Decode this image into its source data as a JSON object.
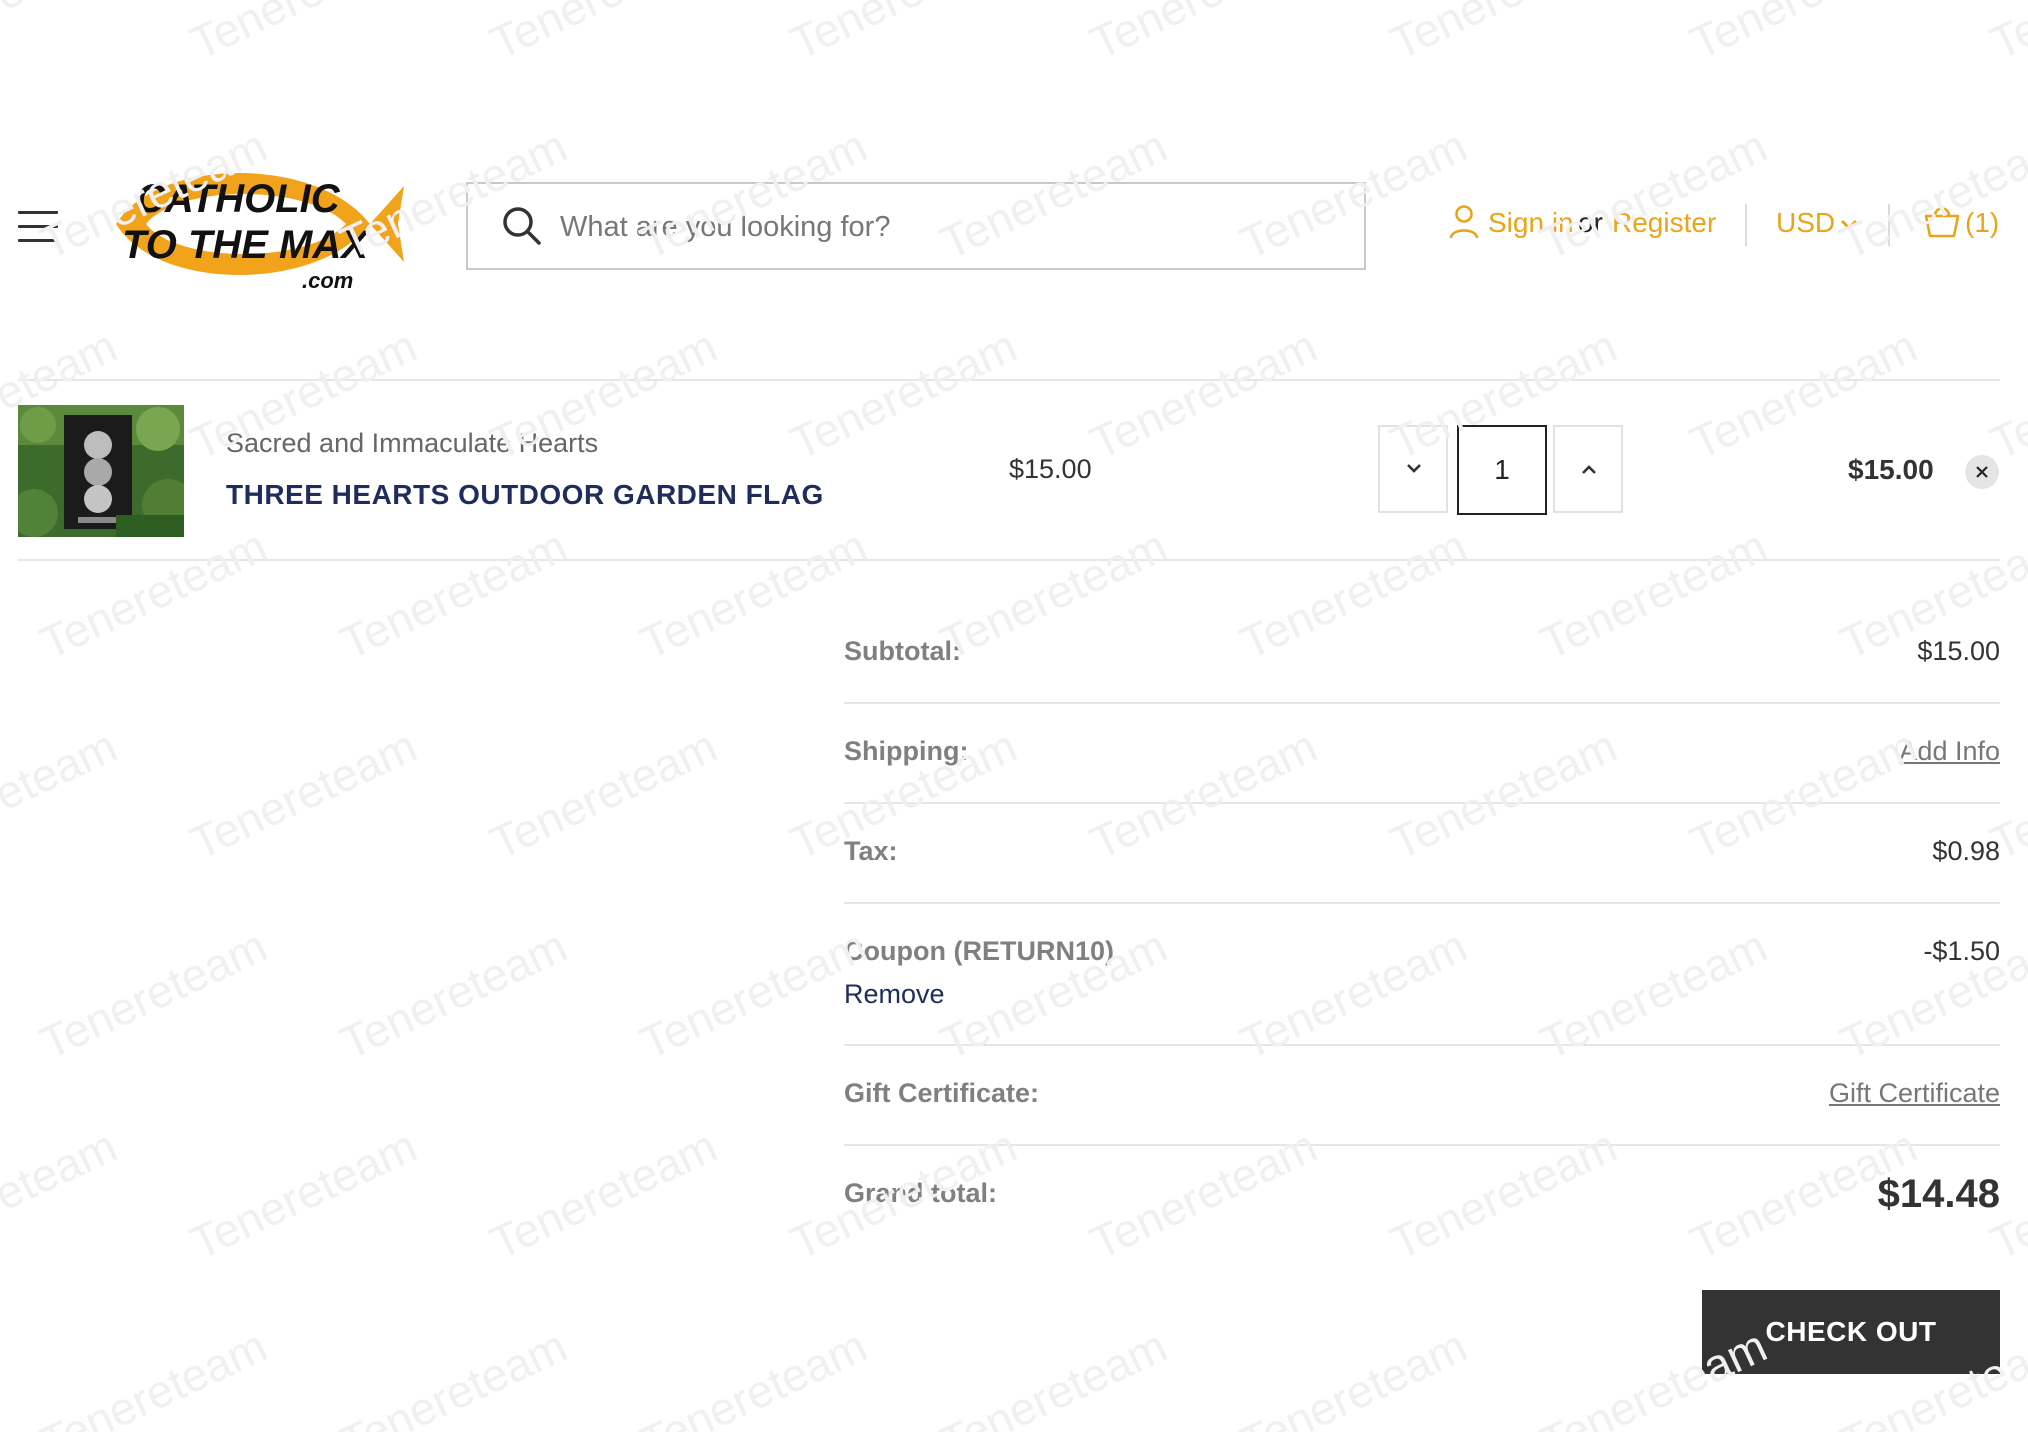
{
  "header": {
    "logo": {
      "line1": "CATHOLIC",
      "line2": "TO THE MAX",
      "line3": ".com"
    },
    "search": {
      "placeholder": "What are you looking for?"
    },
    "account": {
      "sign_in": "Sign in",
      "or": "or",
      "register": "Register"
    },
    "currency": "USD",
    "cart": {
      "count_label": "(1)"
    }
  },
  "cart_item": {
    "brand": "Sacred and Immaculate Hearts",
    "name": "THREE HEARTS OUTDOOR GARDEN FLAG",
    "price": "$15.00",
    "quantity": "1",
    "total": "$15.00"
  },
  "totals": {
    "subtotal_label": "Subtotal:",
    "subtotal_value": "$15.00",
    "shipping_label": "Shipping:",
    "shipping_link": "Add Info",
    "tax_label": "Tax:",
    "tax_value": "$0.98",
    "coupon_label": "Coupon (RETURN10)",
    "coupon_value": "-$1.50",
    "coupon_remove": "Remove",
    "gift_label": "Gift Certificate:",
    "gift_link": "Gift Certificate",
    "grand_label": "Grand total:",
    "grand_value": "$14.48"
  },
  "checkout_button": "CHECK OUT",
  "watermark": "Tenereteam",
  "colors": {
    "accent": "#e8a41a",
    "product_link": "#1f2d5c",
    "button_bg": "#333333"
  },
  "icons": {
    "menu": "hamburger-icon",
    "search": "search-icon",
    "user": "user-icon",
    "currency_dropdown": "chevron-down-icon",
    "cart": "basket-icon",
    "qty_decrease": "chevron-down-icon",
    "qty_increase": "chevron-up-icon",
    "remove_item": "close-icon"
  }
}
